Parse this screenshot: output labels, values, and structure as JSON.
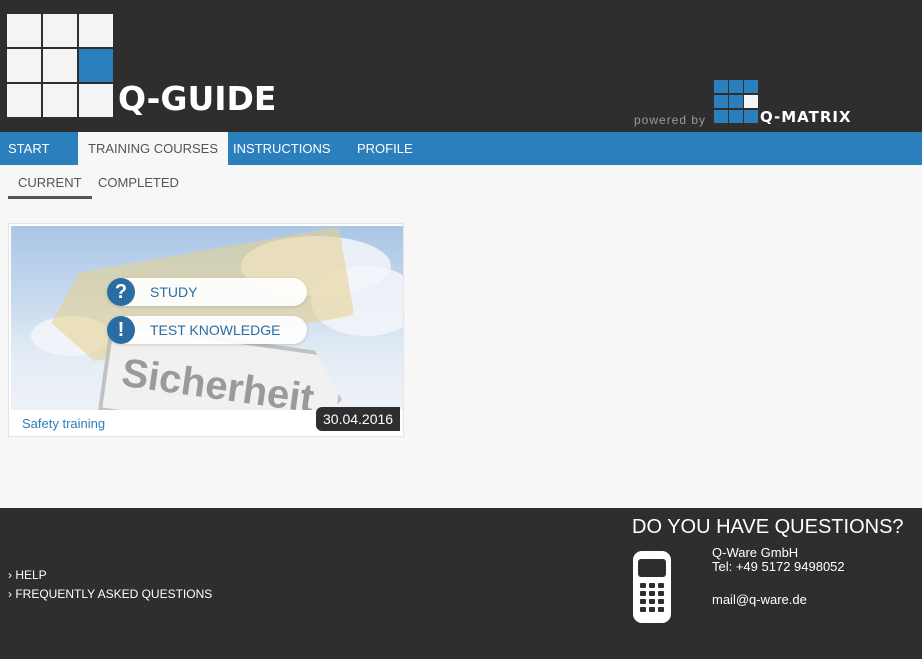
{
  "header": {
    "brand": "Q-GUIDE",
    "powered_by": "powered by",
    "partner": "Q-MATRIX"
  },
  "nav": {
    "items": [
      "START",
      "TRAINING COURSES",
      "INSTRUCTIONS",
      "PROFILE"
    ],
    "active": "TRAINING COURSES"
  },
  "subtabs": {
    "items": [
      "CURRENT",
      "COMPLETED"
    ],
    "active": "CURRENT"
  },
  "course": {
    "title": "Safety training",
    "date": "30.04.2016",
    "image_text": "Sicherheit",
    "actions": [
      {
        "label": "STUDY",
        "icon": "question-icon",
        "glyph": "?"
      },
      {
        "label": "TEST KNOWLEDGE",
        "icon": "exclamation-icon",
        "glyph": "!"
      }
    ]
  },
  "footer": {
    "links": [
      "› HELP",
      "› FREQUENTLY ASKED QUESTIONS"
    ],
    "questions_title": "DO YOU HAVE QUESTIONS?",
    "company": "Q-Ware GmbH",
    "tel": "Tel: +49 5172 9498052",
    "email": "mail@q-ware.de"
  },
  "colors": {
    "accent": "#2b7fbd",
    "dark": "#2e2e2e",
    "background": "#f7f7f7"
  }
}
